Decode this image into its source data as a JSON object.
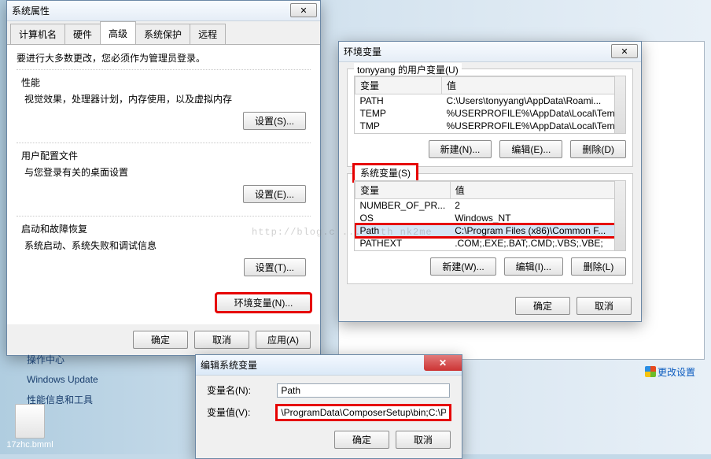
{
  "sysprops": {
    "title": "系统属性",
    "tabs": [
      "计算机名",
      "硬件",
      "高级",
      "系统保护",
      "远程"
    ],
    "active_tab_index": 2,
    "intro": "要进行大多数更改，您必须作为管理员登录。",
    "perf": {
      "title": "性能",
      "desc": "视觉效果，处理器计划，内存使用，以及虚拟内存",
      "btn": "设置(S)..."
    },
    "user": {
      "title": "用户配置文件",
      "desc": "与您登录有关的桌面设置",
      "btn": "设置(E)..."
    },
    "startup": {
      "title": "启动和故障恢复",
      "desc": "系统启动、系统失败和调试信息",
      "btn": "设置(T)..."
    },
    "envbtn": "环境变量(N)...",
    "ok": "确定",
    "cancel": "取消",
    "apply": "应用(A)"
  },
  "envvar": {
    "title": "环境变量",
    "user_section_title": "tonyyang 的用户变量(U)",
    "headers": {
      "name": "变量",
      "value": "值"
    },
    "user_vars": [
      {
        "name": "PATH",
        "value": "C:\\Users\\tonyyang\\AppData\\Roami..."
      },
      {
        "name": "TEMP",
        "value": "%USERPROFILE%\\AppData\\Local\\Temp"
      },
      {
        "name": "TMP",
        "value": "%USERPROFILE%\\AppData\\Local\\Temp"
      }
    ],
    "sys_section_title": "系统变量(S)",
    "sys_vars": [
      {
        "name": "NUMBER_OF_PR...",
        "value": "2"
      },
      {
        "name": "OS",
        "value": "Windows_NT"
      },
      {
        "name": "Path",
        "value": "C:\\Program Files (x86)\\Common F..."
      },
      {
        "name": "PATHEXT",
        "value": ".COM;.EXE;.BAT;.CMD;.VBS;.VBE;"
      }
    ],
    "new_btn": "新建(N)...",
    "edit_btn": "编辑(E)...",
    "del_btn": "删除(D)",
    "new_btn2": "新建(W)...",
    "edit_btn2": "编辑(I)...",
    "del_btn2": "删除(L)",
    "ok": "确定",
    "cancel": "取消"
  },
  "editdlg": {
    "title": "编辑系统变量",
    "name_label": "变量名(N):",
    "name_value": "Path",
    "value_label": "变量值(V):",
    "value_value": "\\ProgramData\\ComposerSetup\\bin;C:\\Pr",
    "ok": "确定",
    "cancel": "取消"
  },
  "sidebar": {
    "items": [
      "操作中心",
      "Windows Update",
      "性能信息和工具"
    ]
  },
  "desktop_file": "17zhc.bmml",
  "change_settings": "更改设置",
  "watermark": "http://blog.c ... / th nk2me"
}
